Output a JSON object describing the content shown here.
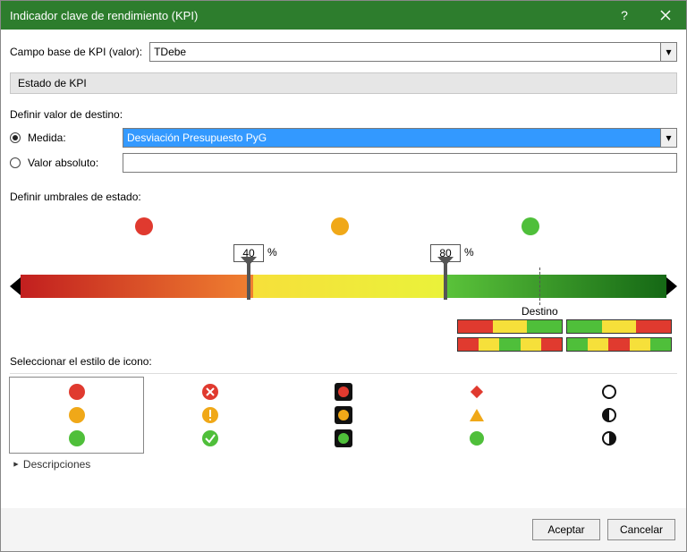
{
  "window": {
    "title": "Indicador clave de rendimiento (KPI)"
  },
  "kpi_field": {
    "label": "Campo base de KPI (valor):",
    "value": "TDebe"
  },
  "state_header": "Estado de KPI",
  "target": {
    "define_label": "Definir valor de destino:",
    "measure_label": "Medida:",
    "measure_value": "Desviación Presupuesto PyG",
    "absolute_label": "Valor absoluto:",
    "absolute_value": "",
    "selected": "measure"
  },
  "thresholds": {
    "label": "Definir umbrales de estado:",
    "low": {
      "value": "40",
      "suffix": "%"
    },
    "high": {
      "value": "80",
      "suffix": "%"
    },
    "destino_label": "Destino",
    "colors": {
      "red": "#e03a2f",
      "orange": "#f0a818",
      "yellow": "#f6e03a",
      "green": "#4fbf3a",
      "darkgreen": "#1f7a1f"
    }
  },
  "icon_style": {
    "label": "Seleccionar el estilo de icono:",
    "selected_index": 0
  },
  "descriptions": {
    "label": "Descripciones",
    "icon": "▼"
  },
  "buttons": {
    "ok": "Aceptar",
    "cancel": "Cancelar"
  }
}
